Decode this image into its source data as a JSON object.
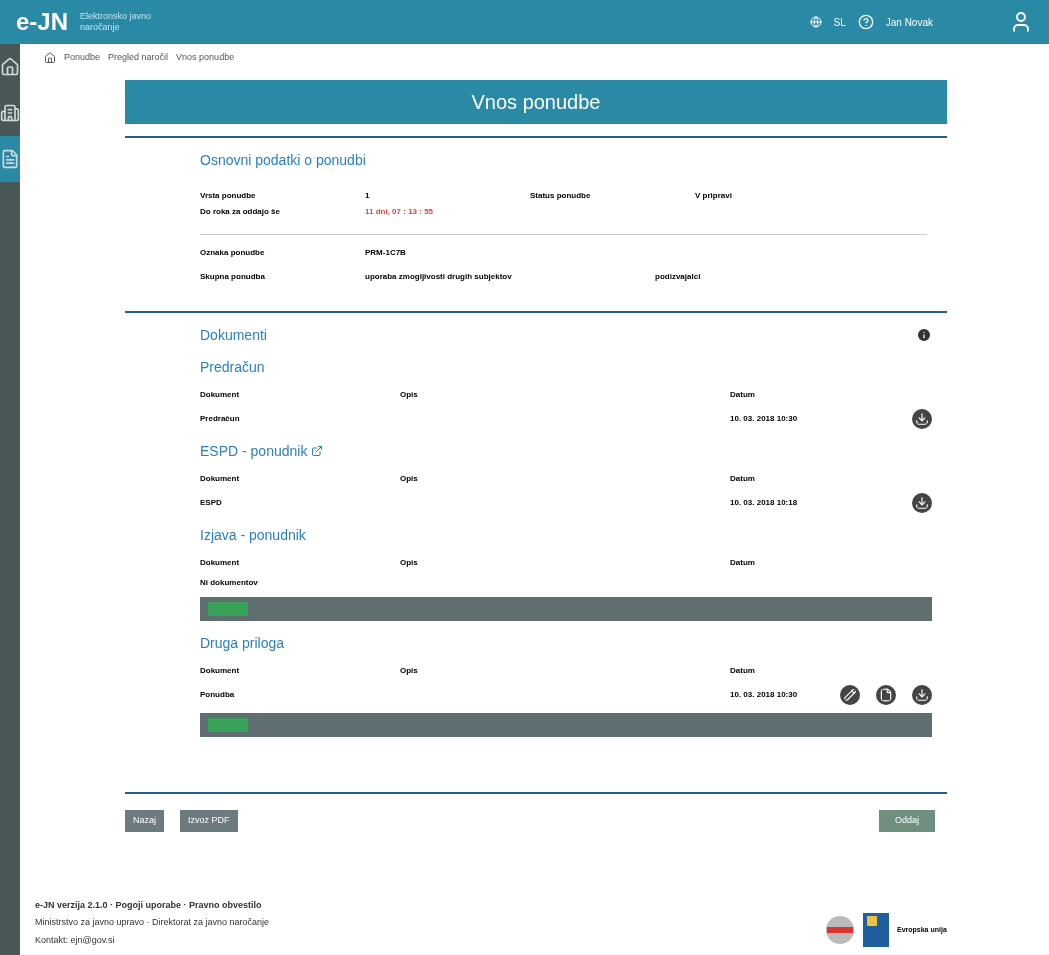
{
  "header": {
    "logo": "e-JN",
    "subtitle": "Elektronsko javno naročanje",
    "language": "SL",
    "user": "Jan Novak"
  },
  "sidebar": {
    "items": [
      {
        "kind": "home",
        "selected": false
      },
      {
        "kind": "tender",
        "selected": false
      },
      {
        "kind": "list",
        "selected": true
      }
    ]
  },
  "breadcrumb": [
    "Ponudbe",
    "Pregled naročil",
    "Vnos ponudbe"
  ],
  "title": "Vnos ponudbe",
  "basic": {
    "heading": "Osnovni podatki o ponudbi",
    "fields": [
      {
        "label": "Vrsta ponudbe",
        "value": "1",
        "alert": false
      },
      {
        "label": "Status ponudbe",
        "value": "V pripravi",
        "alert": false
      },
      {
        "label": "Do roka za oddajo še",
        "value": "11 dni, 07 : 13 : 55",
        "alert": true
      }
    ],
    "fields2": [
      {
        "label": "Oznaka ponudbe",
        "value": "PRM-1C7B"
      },
      {
        "label": "Skupna ponudba",
        "value": "uporaba zmogljivosti drugih subjektov",
        "extra": "podizvajalci"
      }
    ]
  },
  "documents": {
    "heading": "Dokumenti",
    "sections": [
      {
        "kind": "plain",
        "title": "Predračun",
        "columns": [
          "Dokument",
          "Opis",
          "Datum"
        ],
        "rows": [
          {
            "name": "Predračun",
            "date": "10. 03. 2018 10:30",
            "actions": [
              {
                "kind": "download"
              }
            ]
          }
        ]
      },
      {
        "kind": "linked",
        "title": "ESPD - ponudnik",
        "columns": [
          "Dokument",
          "Opis",
          "Datum"
        ],
        "rows": [
          {
            "name": "ESPD",
            "date": "10. 03. 2018 10:18",
            "actions": [
              {
                "kind": "download"
              }
            ]
          }
        ]
      },
      {
        "kind": "redacted",
        "title": "Izjava - ponudnik",
        "columns": [
          "Dokument",
          "Opis",
          "Datum"
        ],
        "empty": "Ni dokumentov"
      },
      {
        "kind": "redacted",
        "title": "Druga priloga",
        "columns": [
          "Dokument",
          "Opis",
          "Datum"
        ],
        "rows": [
          {
            "name": "Ponudba",
            "date": "10. 03. 2018 10:30",
            "actions": [
              {
                "kind": "edit"
              },
              {
                "kind": "file"
              },
              {
                "kind": "download"
              }
            ]
          }
        ]
      }
    ]
  },
  "buttons": [
    {
      "label": "Nazaj",
      "kind": "secondary"
    },
    {
      "label": "Izvoz PDF",
      "kind": "secondary"
    },
    {
      "label": "Oddaj",
      "kind": "primary"
    }
  ],
  "footer": {
    "line1": "e-JN verzija 2.1.0 · Pogoji uporabe · Pravno obvestilo",
    "line2": "Ministrstvo za javno upravo · Direktorat za javno naročanje",
    "line3": "Kontakt: ejn@gov.si",
    "brand": "Evropska unija"
  }
}
